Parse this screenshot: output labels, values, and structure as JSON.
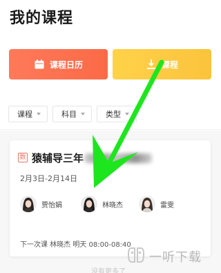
{
  "page": {
    "title": "我的课程"
  },
  "actions": {
    "calendar_label": "课程日历",
    "download_label": "课程"
  },
  "filters": [
    {
      "label": "课程"
    },
    {
      "label": "科目"
    },
    {
      "label": "类型"
    }
  ],
  "course": {
    "subject_badge": "数",
    "title": "猿辅导三年",
    "dates": "2月3日-2月14日",
    "teachers": [
      {
        "name": "贾怡娟"
      },
      {
        "name": "林晓杰"
      },
      {
        "name": "雷雯"
      }
    ],
    "next_lesson": "下一次课 林晓杰 明天 08:00-08:40"
  },
  "footer": {
    "empty_text": "没有更多了"
  },
  "watermark": {
    "text": "一听下载"
  },
  "colors": {
    "calendar_button": "#fb6a47",
    "download_button": "#fbc33c",
    "annotation_arrow": "#1ee61e"
  }
}
